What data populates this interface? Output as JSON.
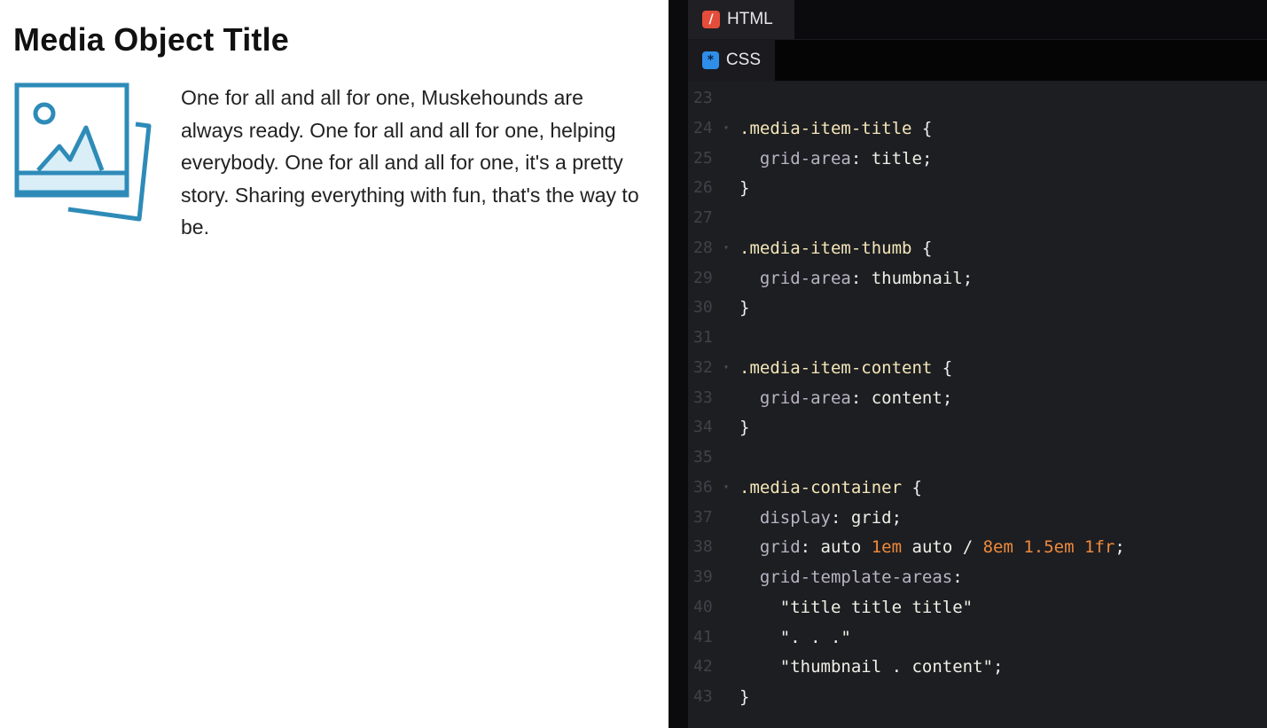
{
  "preview": {
    "title": "Media Object Title",
    "content": "One for all and all for one, Muskehounds are always ready. One for all and all for one, helping everybody. One for all and all for one, it's a pretty story. Sharing everything with fun, that's the way to be.",
    "thumbnail_icon": "image-placeholder-icon",
    "accent_color": "#2e8bb8"
  },
  "editor": {
    "tabs": [
      {
        "label": "HTML",
        "icon": "html-icon"
      },
      {
        "label": "CSS",
        "icon": "css-icon"
      }
    ],
    "lines": [
      {
        "num": "23",
        "fold": false,
        "tokens": []
      },
      {
        "num": "24",
        "fold": true,
        "tokens": [
          {
            "c": "t-sel",
            "t": ".media-item-title"
          },
          {
            "c": "t-punc",
            "t": " {"
          }
        ]
      },
      {
        "num": "25",
        "fold": false,
        "tokens": [
          {
            "c": "t-prop",
            "t": "  grid-area"
          },
          {
            "c": "t-punc",
            "t": ": "
          },
          {
            "c": "t-val",
            "t": "title"
          },
          {
            "c": "t-punc",
            "t": ";"
          }
        ]
      },
      {
        "num": "26",
        "fold": false,
        "tokens": [
          {
            "c": "t-punc",
            "t": "}"
          }
        ]
      },
      {
        "num": "27",
        "fold": false,
        "tokens": []
      },
      {
        "num": "28",
        "fold": true,
        "tokens": [
          {
            "c": "t-sel",
            "t": ".media-item-thumb"
          },
          {
            "c": "t-punc",
            "t": " {"
          }
        ]
      },
      {
        "num": "29",
        "fold": false,
        "tokens": [
          {
            "c": "t-prop",
            "t": "  grid-area"
          },
          {
            "c": "t-punc",
            "t": ": "
          },
          {
            "c": "t-val",
            "t": "thumbnail"
          },
          {
            "c": "t-punc",
            "t": ";"
          }
        ]
      },
      {
        "num": "30",
        "fold": false,
        "tokens": [
          {
            "c": "t-punc",
            "t": "}"
          }
        ]
      },
      {
        "num": "31",
        "fold": false,
        "tokens": []
      },
      {
        "num": "32",
        "fold": true,
        "tokens": [
          {
            "c": "t-sel",
            "t": ".media-item-content"
          },
          {
            "c": "t-punc",
            "t": " {"
          }
        ]
      },
      {
        "num": "33",
        "fold": false,
        "tokens": [
          {
            "c": "t-prop",
            "t": "  grid-area"
          },
          {
            "c": "t-punc",
            "t": ": "
          },
          {
            "c": "t-val",
            "t": "content"
          },
          {
            "c": "t-punc",
            "t": ";"
          }
        ]
      },
      {
        "num": "34",
        "fold": false,
        "tokens": [
          {
            "c": "t-punc",
            "t": "}"
          }
        ]
      },
      {
        "num": "35",
        "fold": false,
        "tokens": []
      },
      {
        "num": "36",
        "fold": true,
        "tokens": [
          {
            "c": "t-sel",
            "t": ".media-container"
          },
          {
            "c": "t-punc",
            "t": " {"
          }
        ]
      },
      {
        "num": "37",
        "fold": false,
        "tokens": [
          {
            "c": "t-prop",
            "t": "  display"
          },
          {
            "c": "t-punc",
            "t": ": "
          },
          {
            "c": "t-val",
            "t": "grid"
          },
          {
            "c": "t-punc",
            "t": ";"
          }
        ]
      },
      {
        "num": "38",
        "fold": false,
        "tokens": [
          {
            "c": "t-prop",
            "t": "  grid"
          },
          {
            "c": "t-punc",
            "t": ": "
          },
          {
            "c": "t-val",
            "t": "auto "
          },
          {
            "c": "t-num",
            "t": "1em"
          },
          {
            "c": "t-val",
            "t": " auto / "
          },
          {
            "c": "t-num",
            "t": "8em"
          },
          {
            "c": "t-val",
            "t": " "
          },
          {
            "c": "t-num",
            "t": "1.5em"
          },
          {
            "c": "t-val",
            "t": " "
          },
          {
            "c": "t-num",
            "t": "1fr"
          },
          {
            "c": "t-punc",
            "t": ";"
          }
        ]
      },
      {
        "num": "39",
        "fold": false,
        "tokens": [
          {
            "c": "t-prop",
            "t": "  grid-template-areas"
          },
          {
            "c": "t-punc",
            "t": ":"
          }
        ]
      },
      {
        "num": "40",
        "fold": false,
        "tokens": [
          {
            "c": "t-str",
            "t": "    \"title title title\""
          }
        ]
      },
      {
        "num": "41",
        "fold": false,
        "tokens": [
          {
            "c": "t-str",
            "t": "    \". . .\""
          }
        ]
      },
      {
        "num": "42",
        "fold": false,
        "tokens": [
          {
            "c": "t-str",
            "t": "    \"thumbnail . content\""
          },
          {
            "c": "t-punc",
            "t": ";"
          }
        ]
      },
      {
        "num": "43",
        "fold": false,
        "tokens": [
          {
            "c": "t-punc",
            "t": "}"
          }
        ]
      }
    ]
  }
}
